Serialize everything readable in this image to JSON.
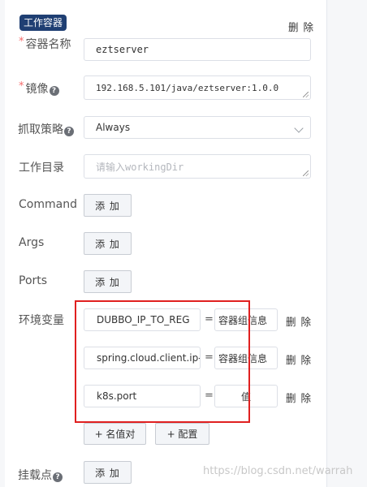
{
  "section": {
    "title": "工作容器",
    "delete_label": "删 除"
  },
  "fields": {
    "name": {
      "label": "容器名称",
      "value": "eztserver"
    },
    "image": {
      "label": "镜像",
      "value": "192.168.5.101/java/eztserver:1.0.0"
    },
    "pull_policy": {
      "label": "抓取策略",
      "value": "Always"
    },
    "workdir": {
      "label": "工作目录",
      "placeholder": "请输入workingDir"
    },
    "command": {
      "label": "Command",
      "add_label": "添 加"
    },
    "args": {
      "label": "Args",
      "add_label": "添 加"
    },
    "ports": {
      "label": "Ports",
      "add_label": "添 加"
    },
    "volumes": {
      "label": "挂载点",
      "add_label": "添 加"
    }
  },
  "env": {
    "label": "环境变量",
    "equals": "=",
    "delete_label": "删 除",
    "rows": [
      {
        "key": "DUBBO_IP_TO_REG",
        "value": "容器组信息"
      },
      {
        "key": "spring.cloud.client.ip-",
        "value": "容器组信息"
      },
      {
        "key": "k8s.port",
        "value": "值"
      }
    ],
    "add_pair_label": "+ 名值对",
    "add_config_label": "+ 配置"
  },
  "watermark": "https://blog.csdn.net/warrah",
  "colors": {
    "accent": "#1f3f73",
    "required": "#f56c6c",
    "highlight": "#e02020"
  }
}
